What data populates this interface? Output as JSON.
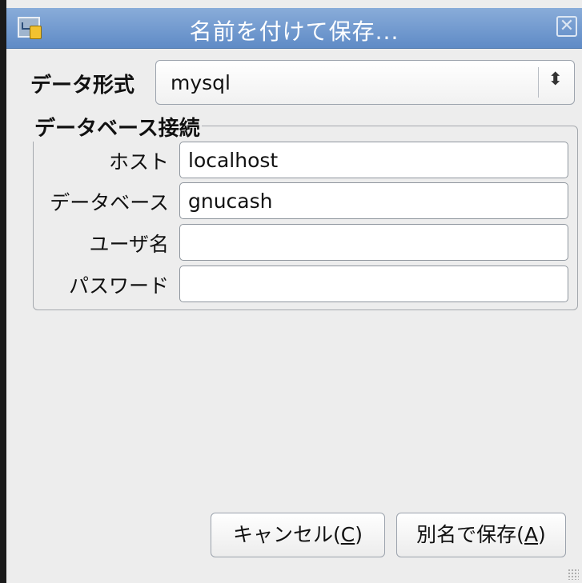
{
  "window": {
    "title": "名前を付けて保存..."
  },
  "format": {
    "label": "データ形式",
    "selected": "mysql"
  },
  "connection": {
    "group_title": "データベース接続",
    "host": {
      "label": "ホスト",
      "value": "localhost"
    },
    "database": {
      "label": "データベース",
      "value": "gnucash"
    },
    "username": {
      "label": "ユーザ名",
      "value": ""
    },
    "password": {
      "label": "パスワード",
      "value": ""
    }
  },
  "buttons": {
    "cancel": {
      "text": "キャンセル(",
      "mnemonic": "C",
      "suffix": ")"
    },
    "save_as": {
      "text": "別名で保存(",
      "mnemonic": "A",
      "suffix": ")"
    }
  },
  "icons": {
    "app": "gnucash-app-icon",
    "close": "close-icon",
    "select_arrows": "updown-chevron-icon",
    "resize": "resize-grip-icon"
  }
}
